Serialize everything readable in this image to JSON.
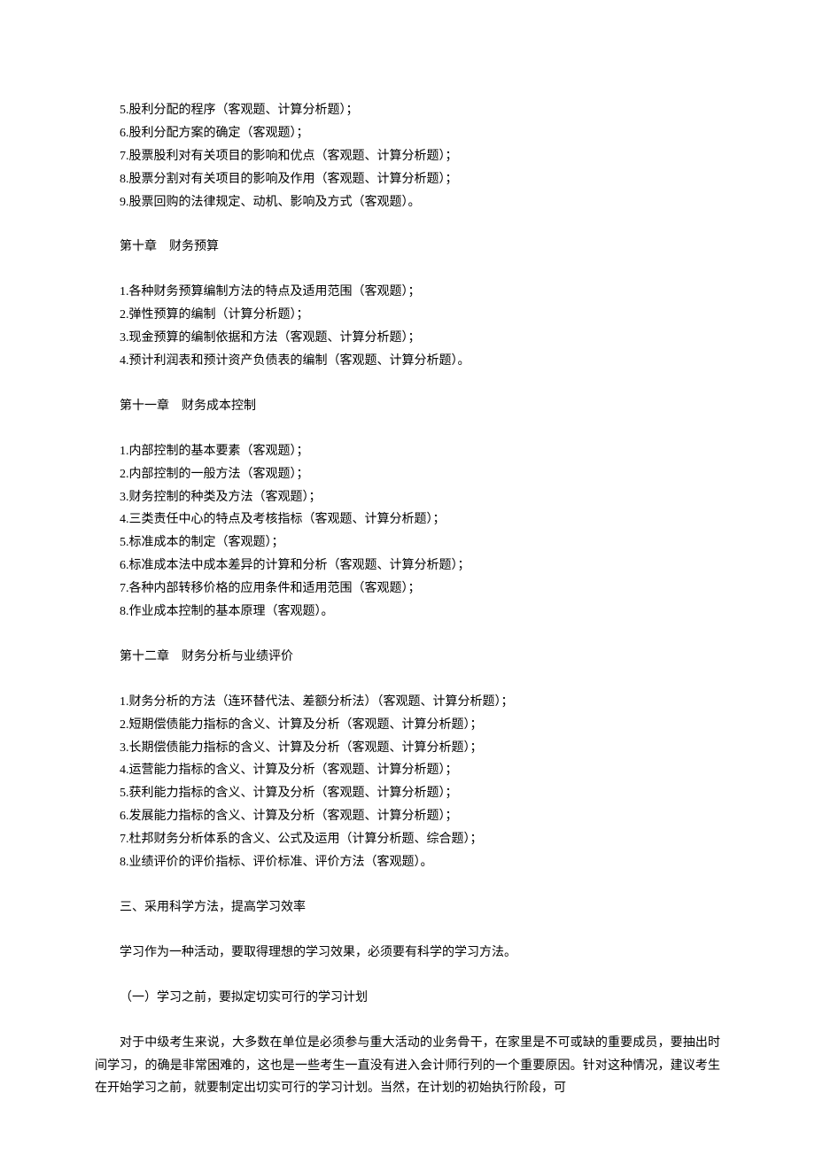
{
  "sections": [
    {
      "type": "line",
      "class": "indent",
      "text": "5.股利分配的程序（客观题、计算分析题）；"
    },
    {
      "type": "line",
      "class": "indent",
      "text": "6.股利分配方案的确定（客观题）；"
    },
    {
      "type": "line",
      "class": "indent",
      "text": "7.股票股利对有关项目的影响和优点（客观题、计算分析题）；"
    },
    {
      "type": "line",
      "class": "indent",
      "text": "8.股票分割对有关项目的影响及作用（客观题、计算分析题）；"
    },
    {
      "type": "line",
      "class": "indent",
      "text": "9.股票回购的法律规定、动机、影响及方式（客观题）。"
    },
    {
      "type": "spacer"
    },
    {
      "type": "line",
      "class": "indent",
      "text": "第十章　财务预算"
    },
    {
      "type": "spacer"
    },
    {
      "type": "line",
      "class": "indent",
      "text": "1.各种财务预算编制方法的特点及适用范围（客观题）；"
    },
    {
      "type": "line",
      "class": "indent",
      "text": "2.弹性预算的编制（计算分析题）；"
    },
    {
      "type": "line",
      "class": "indent",
      "text": "3.现金预算的编制依据和方法（客观题、计算分析题）；"
    },
    {
      "type": "line",
      "class": "indent",
      "text": "4.预计利润表和预计资产负债表的编制（客观题、计算分析题）。"
    },
    {
      "type": "spacer"
    },
    {
      "type": "line",
      "class": "indent",
      "text": "第十一章　财务成本控制"
    },
    {
      "type": "spacer"
    },
    {
      "type": "line",
      "class": "indent",
      "text": "1.内部控制的基本要素（客观题）；"
    },
    {
      "type": "line",
      "class": "indent",
      "text": "2.内部控制的一般方法（客观题）；"
    },
    {
      "type": "line",
      "class": "indent",
      "text": "3.财务控制的种类及方法（客观题）；"
    },
    {
      "type": "line",
      "class": "indent",
      "text": "4.三类责任中心的特点及考核指标（客观题、计算分析题）；"
    },
    {
      "type": "line",
      "class": "indent",
      "text": "5.标准成本的制定（客观题）；"
    },
    {
      "type": "line",
      "class": "indent",
      "text": "6.标准成本法中成本差异的计算和分析（客观题、计算分析题）；"
    },
    {
      "type": "line",
      "class": "indent",
      "text": "7.各种内部转移价格的应用条件和适用范围（客观题）；"
    },
    {
      "type": "line",
      "class": "indent",
      "text": "8.作业成本控制的基本原理（客观题）。"
    },
    {
      "type": "spacer"
    },
    {
      "type": "line",
      "class": "indent",
      "text": "第十二章　财务分析与业绩评价"
    },
    {
      "type": "spacer"
    },
    {
      "type": "line",
      "class": "indent",
      "text": "1.财务分析的方法（连环替代法、差额分析法）（客观题、计算分析题）；"
    },
    {
      "type": "line",
      "class": "indent",
      "text": "2.短期偿债能力指标的含义、计算及分析（客观题、计算分析题）；"
    },
    {
      "type": "line",
      "class": "indent",
      "text": "3.长期偿债能力指标的含义、计算及分析（客观题、计算分析题）；"
    },
    {
      "type": "line",
      "class": "indent",
      "text": "4.运营能力指标的含义、计算及分析（客观题、计算分析题）；"
    },
    {
      "type": "line",
      "class": "indent",
      "text": "5.获利能力指标的含义、计算及分析（客观题、计算分析题）；"
    },
    {
      "type": "line",
      "class": "indent",
      "text": "6.发展能力指标的含义、计算及分析（客观题、计算分析题）；"
    },
    {
      "type": "line",
      "class": "indent",
      "text": "7.杜邦财务分析体系的含义、公式及运用（计算分析题、综合题）；"
    },
    {
      "type": "line",
      "class": "indent",
      "text": "8.业绩评价的评价指标、评价标准、评价方法（客观题）。"
    },
    {
      "type": "spacer"
    },
    {
      "type": "line",
      "class": "indent",
      "text": "三、采用科学方法，提高学习效率"
    },
    {
      "type": "spacer"
    },
    {
      "type": "line",
      "class": "indent",
      "text": "学习作为一种活动，要取得理想的学习效果，必须要有科学的学习方法。"
    },
    {
      "type": "spacer"
    },
    {
      "type": "line",
      "class": "indent",
      "text": "（一）学习之前，要拟定切实可行的学习计划"
    },
    {
      "type": "spacer"
    },
    {
      "type": "line",
      "class": "indent justify",
      "text": "对于中级考生来说，大多数在单位是必须参与重大活动的业务骨干，在家里是不可或缺的重要成员，要抽出时间学习，的确是非常困难的，这也是一些考生一直没有进入会计师行列的一个重要原因。针对这种情况，建议考生在开始学习之前，就要制定出切实可行的学习计划。当然，在计划的初始执行阶段，可"
    }
  ]
}
